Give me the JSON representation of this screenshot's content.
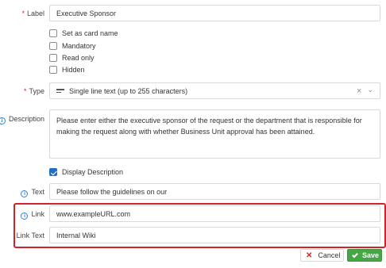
{
  "form": {
    "label": {
      "label": "Label",
      "required_mark": "*",
      "value": "Executive Sponsor"
    },
    "options": [
      {
        "label": "Set as card name",
        "checked": false
      },
      {
        "label": "Mandatory",
        "checked": false
      },
      {
        "label": "Read only",
        "checked": false
      },
      {
        "label": "Hidden",
        "checked": false
      }
    ],
    "type": {
      "label": "Type",
      "required_mark": "*",
      "value": "Single line text (up to 255 characters)",
      "icon": "text-lines-icon",
      "clear_symbol": "×",
      "dropdown_symbol": "⌄"
    },
    "description": {
      "label": "Description",
      "icon": "info-icon",
      "value": "Please enter either the executive sponsor of the request or the department that is responsible for making the request along with whether Business Unit approval has been attained."
    },
    "display_description": {
      "label": "Display Description",
      "checked": true
    },
    "text": {
      "label": "Text",
      "icon": "info-icon",
      "value": "Please follow the guidelines on our"
    },
    "link": {
      "label": "Link",
      "icon": "info-icon",
      "value": "www.exampleURL.com"
    },
    "link_text": {
      "label": "Link Text",
      "value": "Internal Wiki"
    }
  },
  "actions": {
    "cancel_label": "Cancel",
    "save_label": "Save"
  },
  "colors": {
    "highlight": "#d3232a",
    "save": "#44a644",
    "checkbox_checked": "#1f6fc5",
    "info": "#2f80d1",
    "required": "#e0212a"
  }
}
